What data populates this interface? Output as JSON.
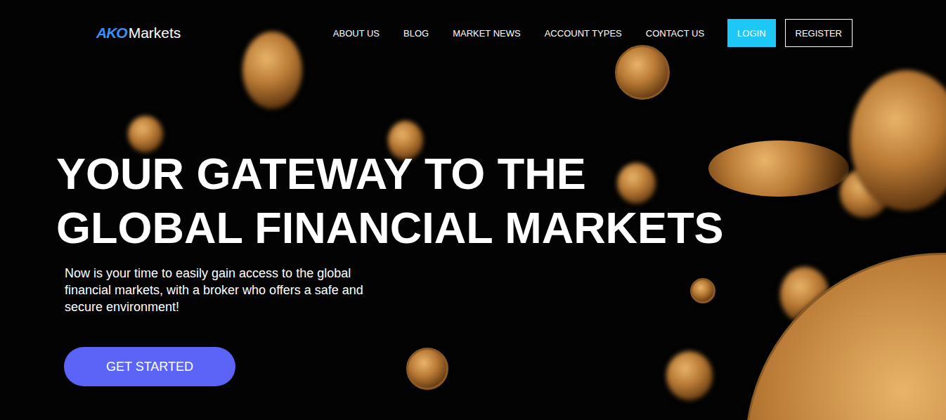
{
  "logo": {
    "mark": "AKO",
    "text": "Markets"
  },
  "nav": [
    "ABOUT US",
    "BLOG",
    "MARKET NEWS",
    "ACCOUNT TYPES",
    "CONTACT US"
  ],
  "buttons": [
    {
      "label": "LOGIN",
      "kind": "filled"
    },
    {
      "label": "REGISTER",
      "kind": "outline"
    }
  ],
  "hero": {
    "title": [
      "YOUR GATEWAY TO THE",
      "GLOBAL FINANCIAL MARKETS"
    ],
    "subtitle": "Now is your time to easily gain access to the global financial markets, with a broker who offers a safe and secure environment!",
    "cta": "GET STARTED"
  }
}
